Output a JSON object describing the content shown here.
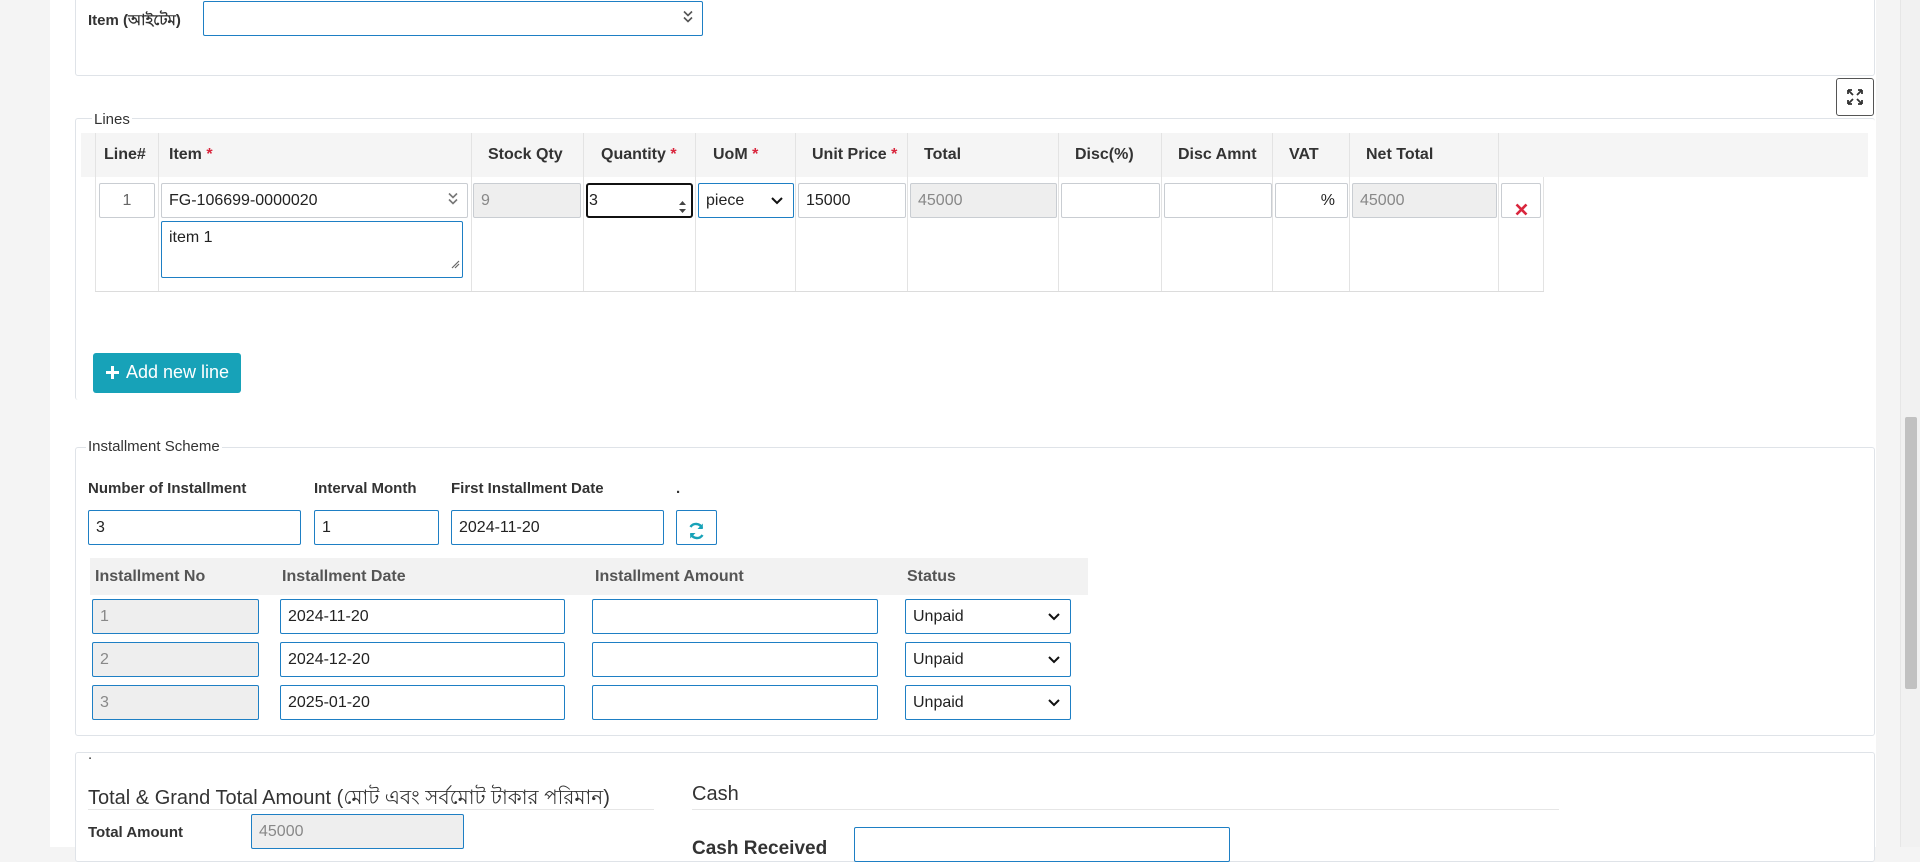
{
  "item_filter": {
    "label": "Item (আইটেম)",
    "value": ""
  },
  "lines": {
    "legend": "Lines",
    "columns": {
      "line_no": "Line#",
      "item": "Item",
      "stock_qty": "Stock Qty",
      "quantity": "Quantity",
      "uom": "UoM",
      "unit_price": "Unit Price",
      "total": "Total",
      "disc_pct": "Disc(%)",
      "disc_amnt": "Disc Amnt",
      "vat": "VAT",
      "net_total": "Net Total"
    },
    "required_mark": "*",
    "row": {
      "line_no": "1",
      "item": "FG-106699-0000020",
      "description": "item 1",
      "stock_qty": "9",
      "quantity": "3",
      "uom": "piece",
      "unit_price": "15000",
      "total": "45000",
      "disc_pct": "",
      "disc_amnt": "",
      "vat_suffix": "%",
      "net_total": "45000"
    },
    "add_button": "Add new line"
  },
  "installment": {
    "legend": "Installment Scheme",
    "labels": {
      "number": "Number of Installment",
      "interval": "Interval Month",
      "first_date": "First Installment Date",
      "dot": "."
    },
    "values": {
      "number": "3",
      "interval": "1",
      "first_date": "2024-11-20"
    },
    "table_headers": {
      "no": "Installment No",
      "date": "Installment Date",
      "amount": "Installment Amount",
      "status": "Status"
    },
    "rows": [
      {
        "no": "1",
        "date": "2024-11-20",
        "amount": "",
        "status": "Unpaid"
      },
      {
        "no": "2",
        "date": "2024-12-20",
        "amount": "",
        "status": "Unpaid"
      },
      {
        "no": "3",
        "date": "2025-01-20",
        "amount": "",
        "status": "Unpaid"
      }
    ]
  },
  "totals": {
    "dot": ".",
    "title": "Total & Grand Total Amount (মোট এবং সর্বমোট টাকার পরিমান)",
    "total_amount_label": "Total Amount",
    "total_amount_value": "45000"
  },
  "cash": {
    "title": "Cash",
    "received_label": "Cash Received"
  },
  "colors": {
    "accent": "#17a2b8",
    "border": "#1e7fc4",
    "danger": "#d9263d"
  }
}
